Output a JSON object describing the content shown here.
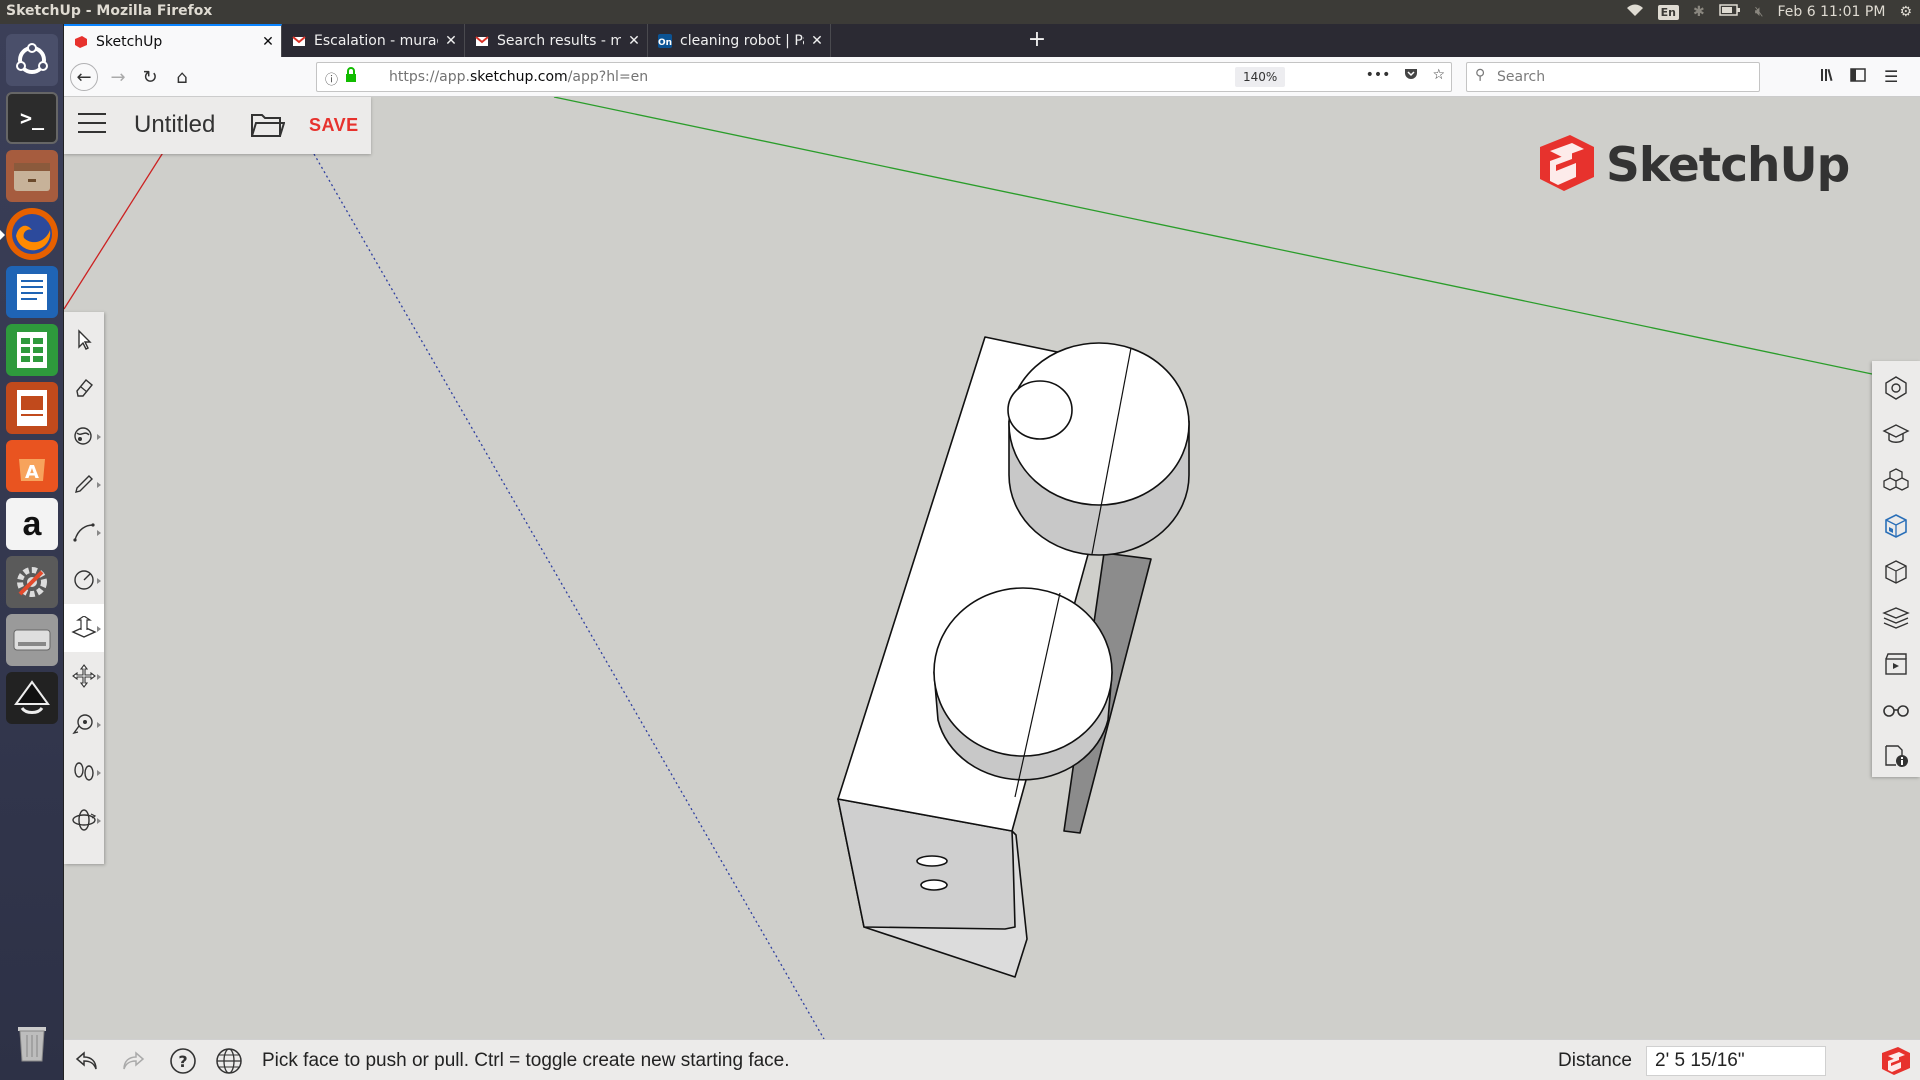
{
  "os": {
    "window_title": "SketchUp - Mozilla Firefox",
    "keyboard_layout": "En",
    "clock": "Feb 6 11:01 PM"
  },
  "launcher": {
    "items": [
      {
        "name": "ubuntu-dash-icon"
      },
      {
        "name": "terminal-icon"
      },
      {
        "name": "files-icon"
      },
      {
        "name": "firefox-icon"
      },
      {
        "name": "writer-icon"
      },
      {
        "name": "calc-icon"
      },
      {
        "name": "impress-icon"
      },
      {
        "name": "software-center-icon"
      },
      {
        "name": "amazon-icon"
      },
      {
        "name": "system-settings-icon"
      },
      {
        "name": "disk-drive-icon"
      },
      {
        "name": "inkscape-icon"
      },
      {
        "name": "trash-icon"
      }
    ],
    "amazon_letter": "a"
  },
  "browser": {
    "tabs": [
      {
        "label": "SketchUp",
        "favicon": "sketchup-favicon",
        "color": "#e7322d"
      },
      {
        "label": "Escalation - muradsaadeh",
        "favicon": "gmail-favicon",
        "color": "#d93025"
      },
      {
        "label": "Search results - muradsaadeh",
        "favicon": "gmail-favicon",
        "color": "#d93025"
      },
      {
        "label": "cleaning robot | Part Studio",
        "favicon": "onshape-favicon",
        "color": "#0b5394"
      }
    ],
    "new_tab": "+",
    "url_prefix": "https://app.",
    "url_domain": "sketchup.com",
    "url_path": "/app?hl=en",
    "zoom": "140%",
    "search_placeholder": "Search"
  },
  "app": {
    "doc_title": "Untitled",
    "save_label": "SAVE",
    "logo_text": "SketchUp",
    "brand_color": "#e7322d",
    "left_tools": [
      {
        "name": "select-tool-icon"
      },
      {
        "name": "eraser-tool-icon"
      },
      {
        "name": "paint-bucket-tool-icon"
      },
      {
        "name": "pencil-line-tool-icon"
      },
      {
        "name": "arc-tool-icon"
      },
      {
        "name": "circle-shape-tool-icon"
      },
      {
        "name": "push-pull-tool-icon"
      },
      {
        "name": "move-tool-icon"
      },
      {
        "name": "tape-measure-tool-icon"
      },
      {
        "name": "walk-tool-icon"
      },
      {
        "name": "orbit-tool-icon"
      }
    ],
    "active_tool": "push-pull-tool-icon",
    "right_panels": [
      {
        "name": "entity-info-panel-icon"
      },
      {
        "name": "instructor-panel-icon"
      },
      {
        "name": "components-panel-icon"
      },
      {
        "name": "materials-panel-icon"
      },
      {
        "name": "styles-panel-icon"
      },
      {
        "name": "layers-panel-icon"
      },
      {
        "name": "scenes-panel-icon"
      },
      {
        "name": "display-panel-icon"
      },
      {
        "name": "model-info-panel-icon"
      }
    ],
    "status": {
      "hint": "Pick face to push or pull. Ctrl = toggle create new starting face.",
      "distance_label": "Distance",
      "distance_value": "2' 5 15/16\""
    }
  }
}
